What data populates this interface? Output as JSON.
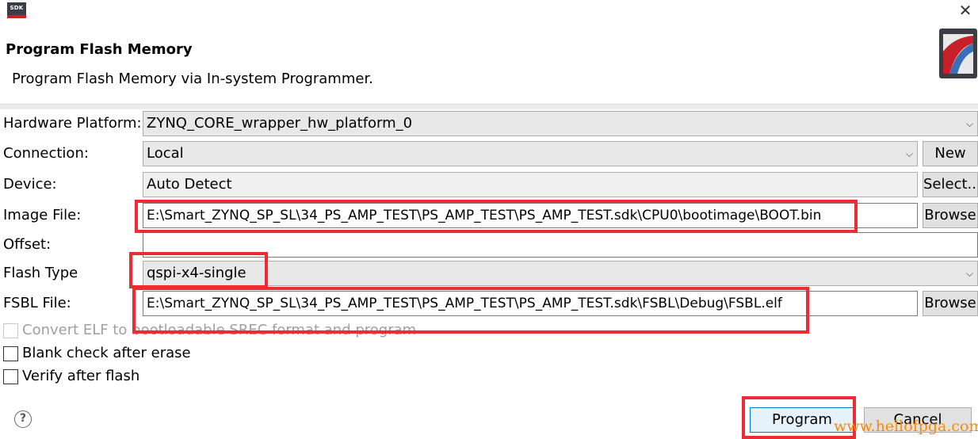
{
  "window": {
    "logo_text": "SDK",
    "close_glyph": "✕",
    "title": "Program Flash Memory",
    "description": "Program Flash Memory via In-system Programmer."
  },
  "form": {
    "hardware_platform": {
      "label": "Hardware Platform:",
      "value": "ZYNQ_CORE_wrapper_hw_platform_0"
    },
    "connection": {
      "label": "Connection:",
      "value": "Local",
      "button": "New"
    },
    "device": {
      "label": "Device:",
      "value": "Auto Detect",
      "button": "Select..."
    },
    "image_file": {
      "label": "Image File:",
      "value": "E:\\Smart_ZYNQ_SP_SL\\34_PS_AMP_TEST\\PS_AMP_TEST\\PS_AMP_TEST.sdk\\CPU0\\bootimage\\BOOT.bin",
      "button": "Browse"
    },
    "offset": {
      "label": "Offset:",
      "value": ""
    },
    "flash_type": {
      "label": "Flash Type",
      "value": "qspi-x4-single"
    },
    "fsbl_file": {
      "label": "FSBL File:",
      "value": "E:\\Smart_ZYNQ_SP_SL\\34_PS_AMP_TEST\\PS_AMP_TEST\\PS_AMP_TEST.sdk\\FSBL\\Debug\\FSBL.elf",
      "button": "Browse"
    }
  },
  "options": {
    "convert_elf": {
      "label": "Convert ELF to bootloadable SREC format and program",
      "checked": false,
      "enabled": false
    },
    "blank_check": {
      "label": "Blank check after erase",
      "checked": false
    },
    "verify": {
      "label": "Verify after flash",
      "checked": false
    }
  },
  "footer": {
    "help_glyph": "?",
    "program_label": "Program",
    "cancel_label": "Cancel"
  },
  "watermark": "www.hellofpga.com",
  "colors": {
    "highlight": "#ee2a33",
    "watermark": "#ff8a00",
    "logo_bar": "#c8202a"
  }
}
